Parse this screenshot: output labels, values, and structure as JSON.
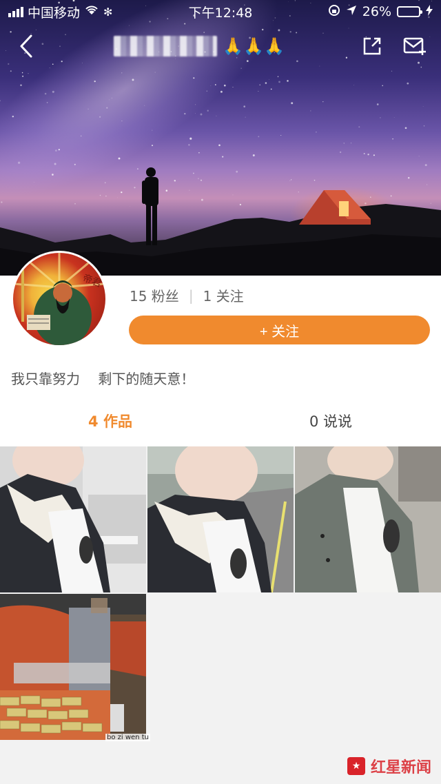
{
  "status_bar": {
    "carrier": "中国移动",
    "time": "下午12:48",
    "battery_percent": "26%",
    "battery_level": 0.26
  },
  "nav": {
    "title_emoji": "🙏🙏🙏"
  },
  "profile": {
    "fans": "15 粉丝",
    "separator": "|",
    "following": "1 关注",
    "follow_button": "+ 关注",
    "bio": "我只靠努力　 剩下的随天意！"
  },
  "tabs": [
    {
      "label": "4 作品",
      "active": true
    },
    {
      "label": "0 说说",
      "active": false
    }
  ],
  "grid": {
    "last_tile_caption": "bo zi wen tu"
  },
  "watermark": {
    "text": "红星新闻"
  },
  "colors": {
    "accent": "#f08a2e",
    "background": "#f2f2f2",
    "watermark": "#d9232a"
  }
}
